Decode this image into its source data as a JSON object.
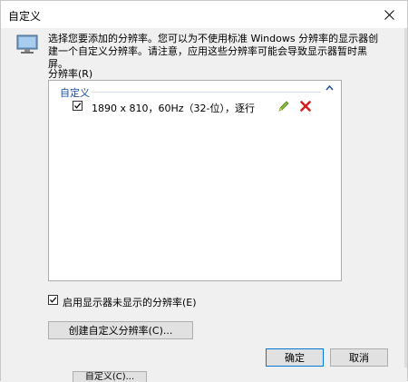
{
  "window": {
    "title": "自定义"
  },
  "description": "选择您要添加的分辨率。您可以为不使用标准 Windows 分辨率的显示器创建一个自定义分辨率。请注意，应用这些分辨率可能会导致显示器暂时黑屏。",
  "resolution_label": "分辨率(R)",
  "list": {
    "group_label": "自定义",
    "items": [
      {
        "text": "1890 x 810，60Hz（32-位），逐行",
        "checked": true
      }
    ]
  },
  "enable_checkbox": {
    "label": "启用显示器未显示的分辨率(E)",
    "checked": true
  },
  "buttons": {
    "create_custom": "创建自定义分辨率(C)...",
    "ok": "确定",
    "cancel": "取消"
  },
  "background_button": "自定义(C)..."
}
